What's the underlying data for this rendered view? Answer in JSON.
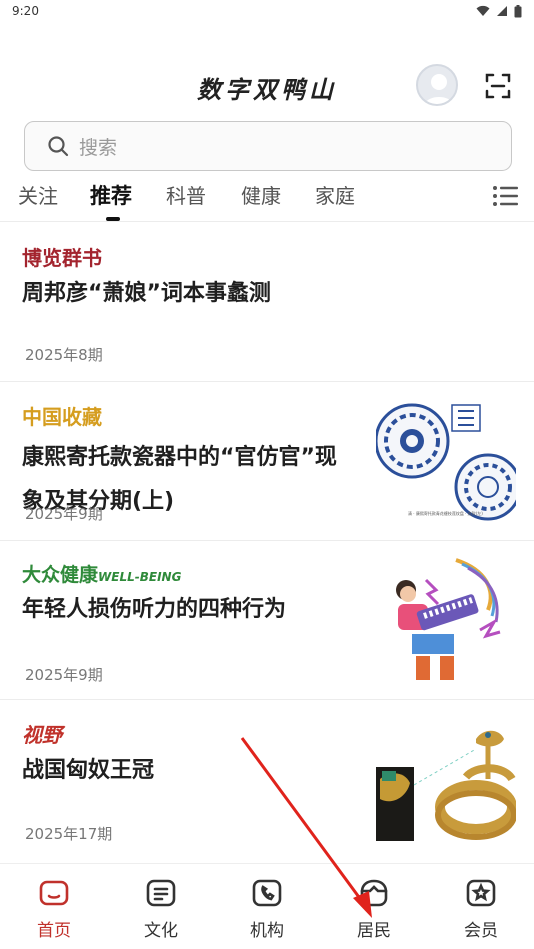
{
  "status": {
    "time": "9:20"
  },
  "header": {
    "title": "数字双鸭山"
  },
  "search": {
    "placeholder": "搜索"
  },
  "tabs": [
    "关注",
    "推荐",
    "科普",
    "健康",
    "家庭"
  ],
  "active_tab": "推荐",
  "articles": [
    {
      "source": "博览群书",
      "title": "周邦彦“萧娘”词本事蠡测",
      "period": "2025年8期"
    },
    {
      "source": "中国收藏",
      "title": "康熙寄托款瓷器中的“官仿官”现象及其分期(上)",
      "period": "2025年9期",
      "image_caption": "清 · 康熙寄托款青花缠枝莲纹盘 · 底款(左)"
    },
    {
      "source": "大众健康",
      "source_en": "WELL-BEING",
      "title": "年轻人损伤听力的四种行为",
      "period": "2025年9期"
    },
    {
      "source": "视野",
      "title": "战国匈奴王冠",
      "period": "2025年17期"
    }
  ],
  "bottom_nav": [
    "首页",
    "文化",
    "机构",
    "居民",
    "会员"
  ],
  "colors": {
    "accent": "#c0312b",
    "brand_red": "#a3242e",
    "brand_gold": "#d59d1f",
    "brand_green": "#2f8a3a"
  }
}
